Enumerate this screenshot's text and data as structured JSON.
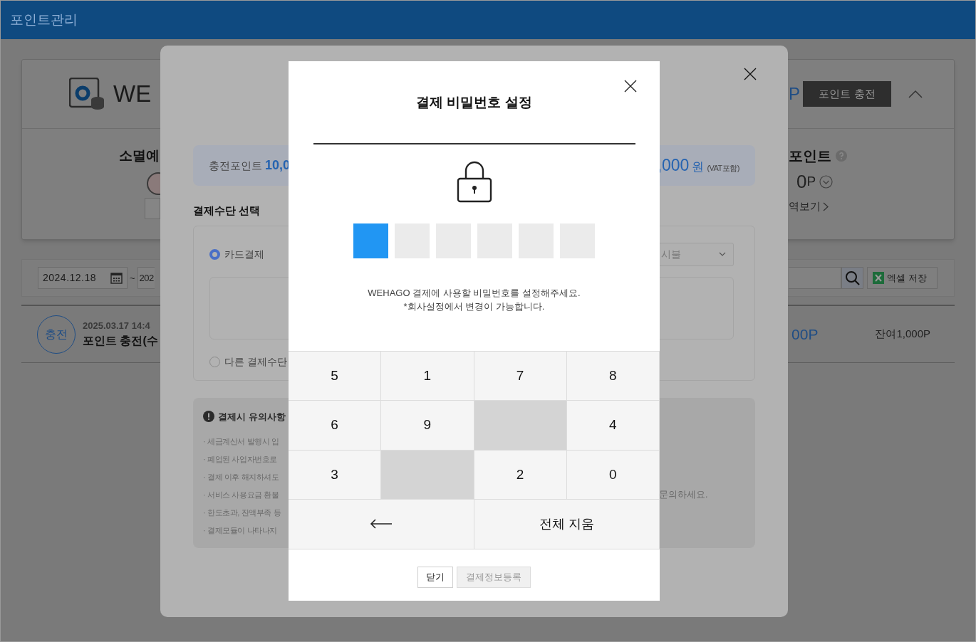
{
  "header": {
    "title": "포인트관리"
  },
  "summary_card": {
    "brand": "WE",
    "balance_unit": "P",
    "charge_button": "포인트 충전",
    "expiring": {
      "title": "소멸예"
    },
    "points": {
      "title": "포인트",
      "value": "0",
      "unit": "P",
      "history_link": "역보기"
    }
  },
  "filter": {
    "start_date": "2024.12.18",
    "separator": "~",
    "end_date": "202",
    "excel_button": "엑셀 저장"
  },
  "history": [
    {
      "badge": "충전",
      "date": "2025.03.17 14:4",
      "title": "포인트 충전(수",
      "amount": "00P",
      "balance": "잔여1,000P"
    }
  ],
  "payment_modal": {
    "charge_label": "충전포인트",
    "charge_value": "10,0",
    "price_value": ",000",
    "price_unit": "원",
    "price_note": "(VAT포함)",
    "method_title": "결제수단 선택",
    "methods": [
      {
        "label": "카드결제",
        "selected": true
      },
      {
        "label": "다른 결제수단",
        "selected": false
      }
    ],
    "installment": "시불",
    "notice_title": "결제시 유의사항",
    "notices": [
      {
        "text": "· 세금계산서 발행시 입"
      },
      {
        "text": "· 폐업된 사업자번호로"
      },
      {
        "text": "· 결제 이후 해지하셔도"
      },
      {
        "text": "· 서비스 사용요금 환불",
        "tail": "문의하세요."
      },
      {
        "text": "· 한도초과, 잔액부족 등"
      },
      {
        "text": "· 결제모듈이 나타나지"
      }
    ]
  },
  "pin_dialog": {
    "title": "결제 비밀번호 설정",
    "pin": [
      {
        "filled": true
      },
      {
        "filled": false
      },
      {
        "filled": false
      },
      {
        "filled": false
      },
      {
        "filled": false
      },
      {
        "filled": false
      }
    ],
    "message": [
      "WEHAGO 결제에 사용할 비밀번호를 설정해주세요.",
      "*회사설정에서 변경이 가능합니다."
    ],
    "keys": [
      {
        "kind": "digit",
        "label": "5"
      },
      {
        "kind": "digit",
        "label": "1"
      },
      {
        "kind": "digit",
        "label": "7"
      },
      {
        "kind": "digit",
        "label": "8"
      },
      {
        "kind": "digit",
        "label": "6"
      },
      {
        "kind": "digit",
        "label": "9"
      },
      {
        "kind": "blank"
      },
      {
        "kind": "digit",
        "label": "4"
      },
      {
        "kind": "digit",
        "label": "3"
      },
      {
        "kind": "blank"
      },
      {
        "kind": "digit",
        "label": "2"
      },
      {
        "kind": "digit",
        "label": "0"
      },
      {
        "kind": "backspace"
      },
      {
        "kind": "clear",
        "label": "전체 지움"
      }
    ],
    "buttons": [
      {
        "label": "닫기",
        "disabled": false
      },
      {
        "label": "결제정보등록",
        "disabled": true
      }
    ]
  }
}
